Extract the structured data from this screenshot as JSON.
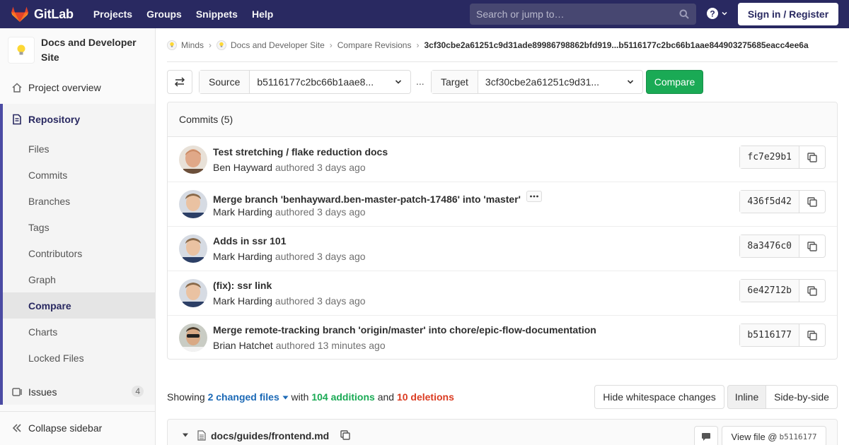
{
  "navbar": {
    "brand": "GitLab",
    "links": [
      "Projects",
      "Groups",
      "Snippets",
      "Help"
    ],
    "search_placeholder": "Search or jump to…",
    "signin": "Sign in / Register",
    "colors": {
      "bg": "#292961",
      "accent": "#fc6d26"
    }
  },
  "sidebar": {
    "project_name": "Docs and Developer Site",
    "overview": "Project overview",
    "repository": "Repository",
    "repo_items": [
      "Files",
      "Commits",
      "Branches",
      "Tags",
      "Contributors",
      "Graph",
      "Compare",
      "Charts",
      "Locked Files"
    ],
    "active_item": "Compare",
    "issues": "Issues",
    "issues_count": "4",
    "collapse": "Collapse sidebar"
  },
  "breadcrumbs": {
    "items": [
      "Minds",
      "Docs and Developer Site",
      "Compare Revisions"
    ],
    "current": "3cf30cbe2a61251c9d31ade89986798862bfd919...b5116177c2bc66b1aae844903275685eacc4ee6a"
  },
  "compare": {
    "source_label": "Source",
    "source_value": "b5116177c2bc66b1aae8...",
    "separator": "...",
    "target_label": "Target",
    "target_value": "3cf30cbe2a61251c9d31...",
    "button": "Compare"
  },
  "commits": {
    "header": "Commits (5)",
    "authored_word": "authored",
    "rows": [
      {
        "title": "Test stretching / flake reduction docs",
        "author": "Ben Hayward",
        "time": "3 days ago",
        "sha": "fc7e29b1",
        "has_more": false
      },
      {
        "title": "Merge branch 'benhayward.ben-master-patch-17486' into 'master'",
        "author": "Mark Harding",
        "time": "3 days ago",
        "sha": "436f5d42",
        "has_more": true
      },
      {
        "title": "Adds in ssr 101",
        "author": "Mark Harding",
        "time": "3 days ago",
        "sha": "8a3476c0",
        "has_more": false
      },
      {
        "title": "(fix): ssr link",
        "author": "Mark Harding",
        "time": "3 days ago",
        "sha": "6e42712b",
        "has_more": false
      },
      {
        "title": "Merge remote-tracking branch 'origin/master' into chore/epic-flow-documentation",
        "author": "Brian Hatchet",
        "time": "13 minutes ago",
        "sha": "b5116177",
        "has_more": false
      }
    ]
  },
  "stats": {
    "showing": "Showing",
    "changed_files": "2 changed files",
    "with": "with",
    "additions": "104 additions",
    "and": "and",
    "deletions": "10 deletions",
    "hide_ws": "Hide whitespace changes",
    "inline": "Inline",
    "side_by_side": "Side-by-side"
  },
  "file": {
    "path": "docs/guides/frontend.md",
    "view_file": "View file @",
    "view_sha": "b5116177"
  }
}
